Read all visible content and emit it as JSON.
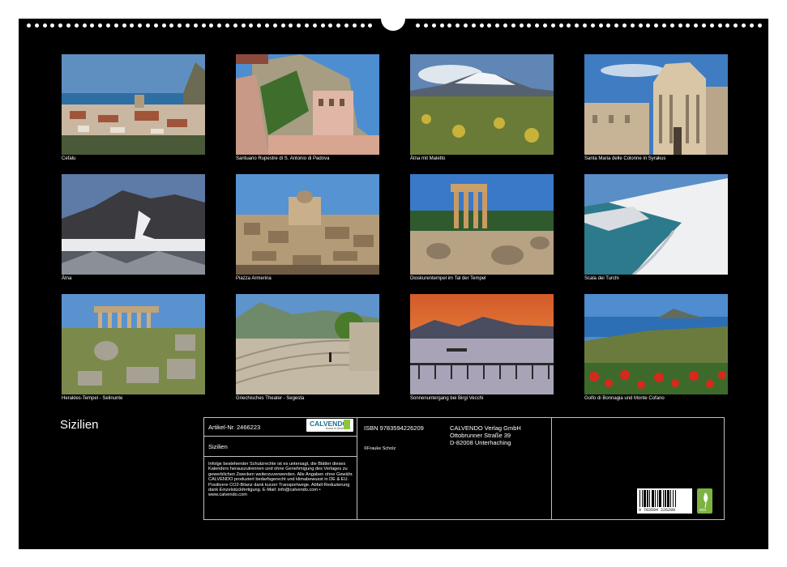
{
  "photos": [
    {
      "caption": "Cefalu"
    },
    {
      "caption": "Santuario Rupestre di S. Antonio di Padova"
    },
    {
      "caption": "Ätna mit Maletto"
    },
    {
      "caption": "Santa Maria delle Colonne in Syrakus"
    },
    {
      "caption": "Ätna"
    },
    {
      "caption": "Piazza Armerina"
    },
    {
      "caption": "Dioskurentempel im Tal der Tempel"
    },
    {
      "caption": "Scala dei Turchi"
    },
    {
      "caption": "Herakles-Tempel - Selinunte"
    },
    {
      "caption": "Griechisches Theater - Segesta"
    },
    {
      "caption": "Sonnenuntergang bei Birgi Vecchi"
    },
    {
      "caption": "Golfo di Bonnagia und Monte Cofano"
    }
  ],
  "cover": {
    "title": "Sizilien"
  },
  "info": {
    "article": "Artikel-Nr. 2466223",
    "product_title": "Sizilien",
    "legal_text": "Infolge bestehender Schutzrechte ist es untersagt, die Blätter dieses Kalenders herauszutrennen und ohne Genehmigung des Verlages zu gewerblichen Zwecken weiterzuverwenden. Alle Angaben ohne Gewähr. CALVENDO produziert bedarfsgerecht und klimabewusst in DE & EU. Positivere CO2-Bilanz dank kurzer Transportwege. Abfall-Reduzierung dank Einzelstückfertigung. E-Mail: info@calvendo.com • www.calvendo.com",
    "isbn": "ISBN 9783594226209",
    "copyright": "©Frauke Scholz",
    "publisher": {
      "name": "CALVENDO Verlag GmbH",
      "street": "Ottobrunner Straße 39",
      "city": "D-82008 Unterhaching"
    },
    "logo_text": "CALVENDO",
    "logo_sub": "Kunst in Serie",
    "barcode_digits": "9 783594 226209",
    "eco_label": "eco"
  }
}
